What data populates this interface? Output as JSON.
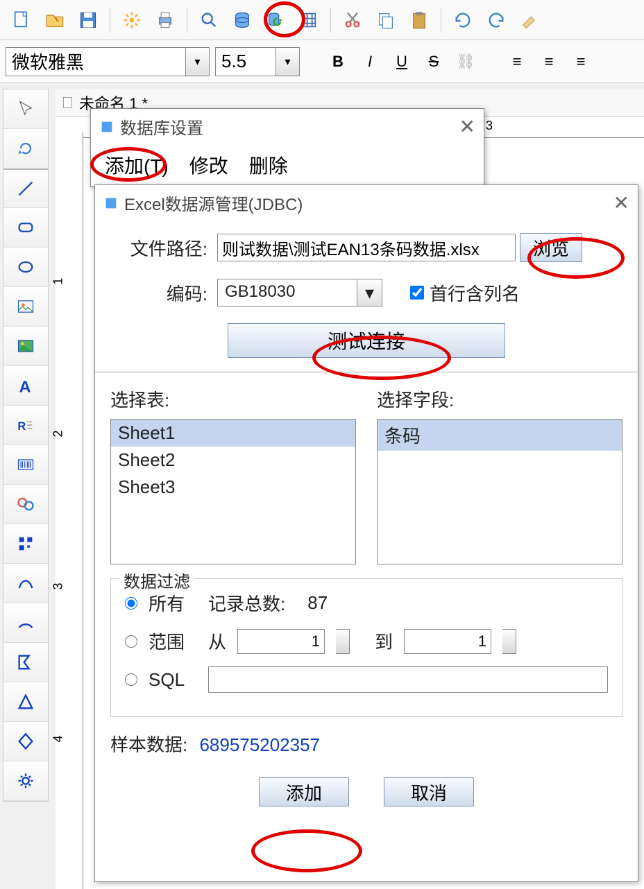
{
  "font_toolbar": {
    "font_name": "微软雅黑",
    "font_size": "5.5",
    "bold": "B",
    "italic": "I",
    "underline": "U",
    "strike": "S"
  },
  "doc_tab": "未命名 1 *",
  "ruler_h": {
    "m3": "3"
  },
  "ruler_v": {
    "m1": "1",
    "m2": "2",
    "m3": "3",
    "m4": "4"
  },
  "db_modal": {
    "title": "数据库设置",
    "menu": {
      "add": "添加(T)",
      "modify": "修改",
      "delete": "删除"
    }
  },
  "excel_modal": {
    "title": "Excel数据源管理(JDBC)",
    "file_label": "文件路径:",
    "file_value": "则试数据\\测试EAN13条码数据.xlsx",
    "browse": "浏览",
    "encoding_label": "编码:",
    "encoding_value": "GB18030",
    "first_row_label": "首行含列名",
    "test_conn": "测试连接",
    "select_table_label": "选择表:",
    "tables": [
      "Sheet1",
      "Sheet2",
      "Sheet3"
    ],
    "select_field_label": "选择字段:",
    "fields": [
      "条码"
    ],
    "filter_legend": "数据过滤",
    "filter_all": "所有",
    "record_total_label": "记录总数:",
    "record_total_value": "87",
    "filter_range": "范围",
    "from_label": "从",
    "from_value": "1",
    "to_label": "到",
    "to_value": "1",
    "filter_sql": "SQL",
    "sample_label": "样本数据:",
    "sample_value": "689575202357",
    "add_btn": "添加",
    "cancel_btn": "取消"
  }
}
